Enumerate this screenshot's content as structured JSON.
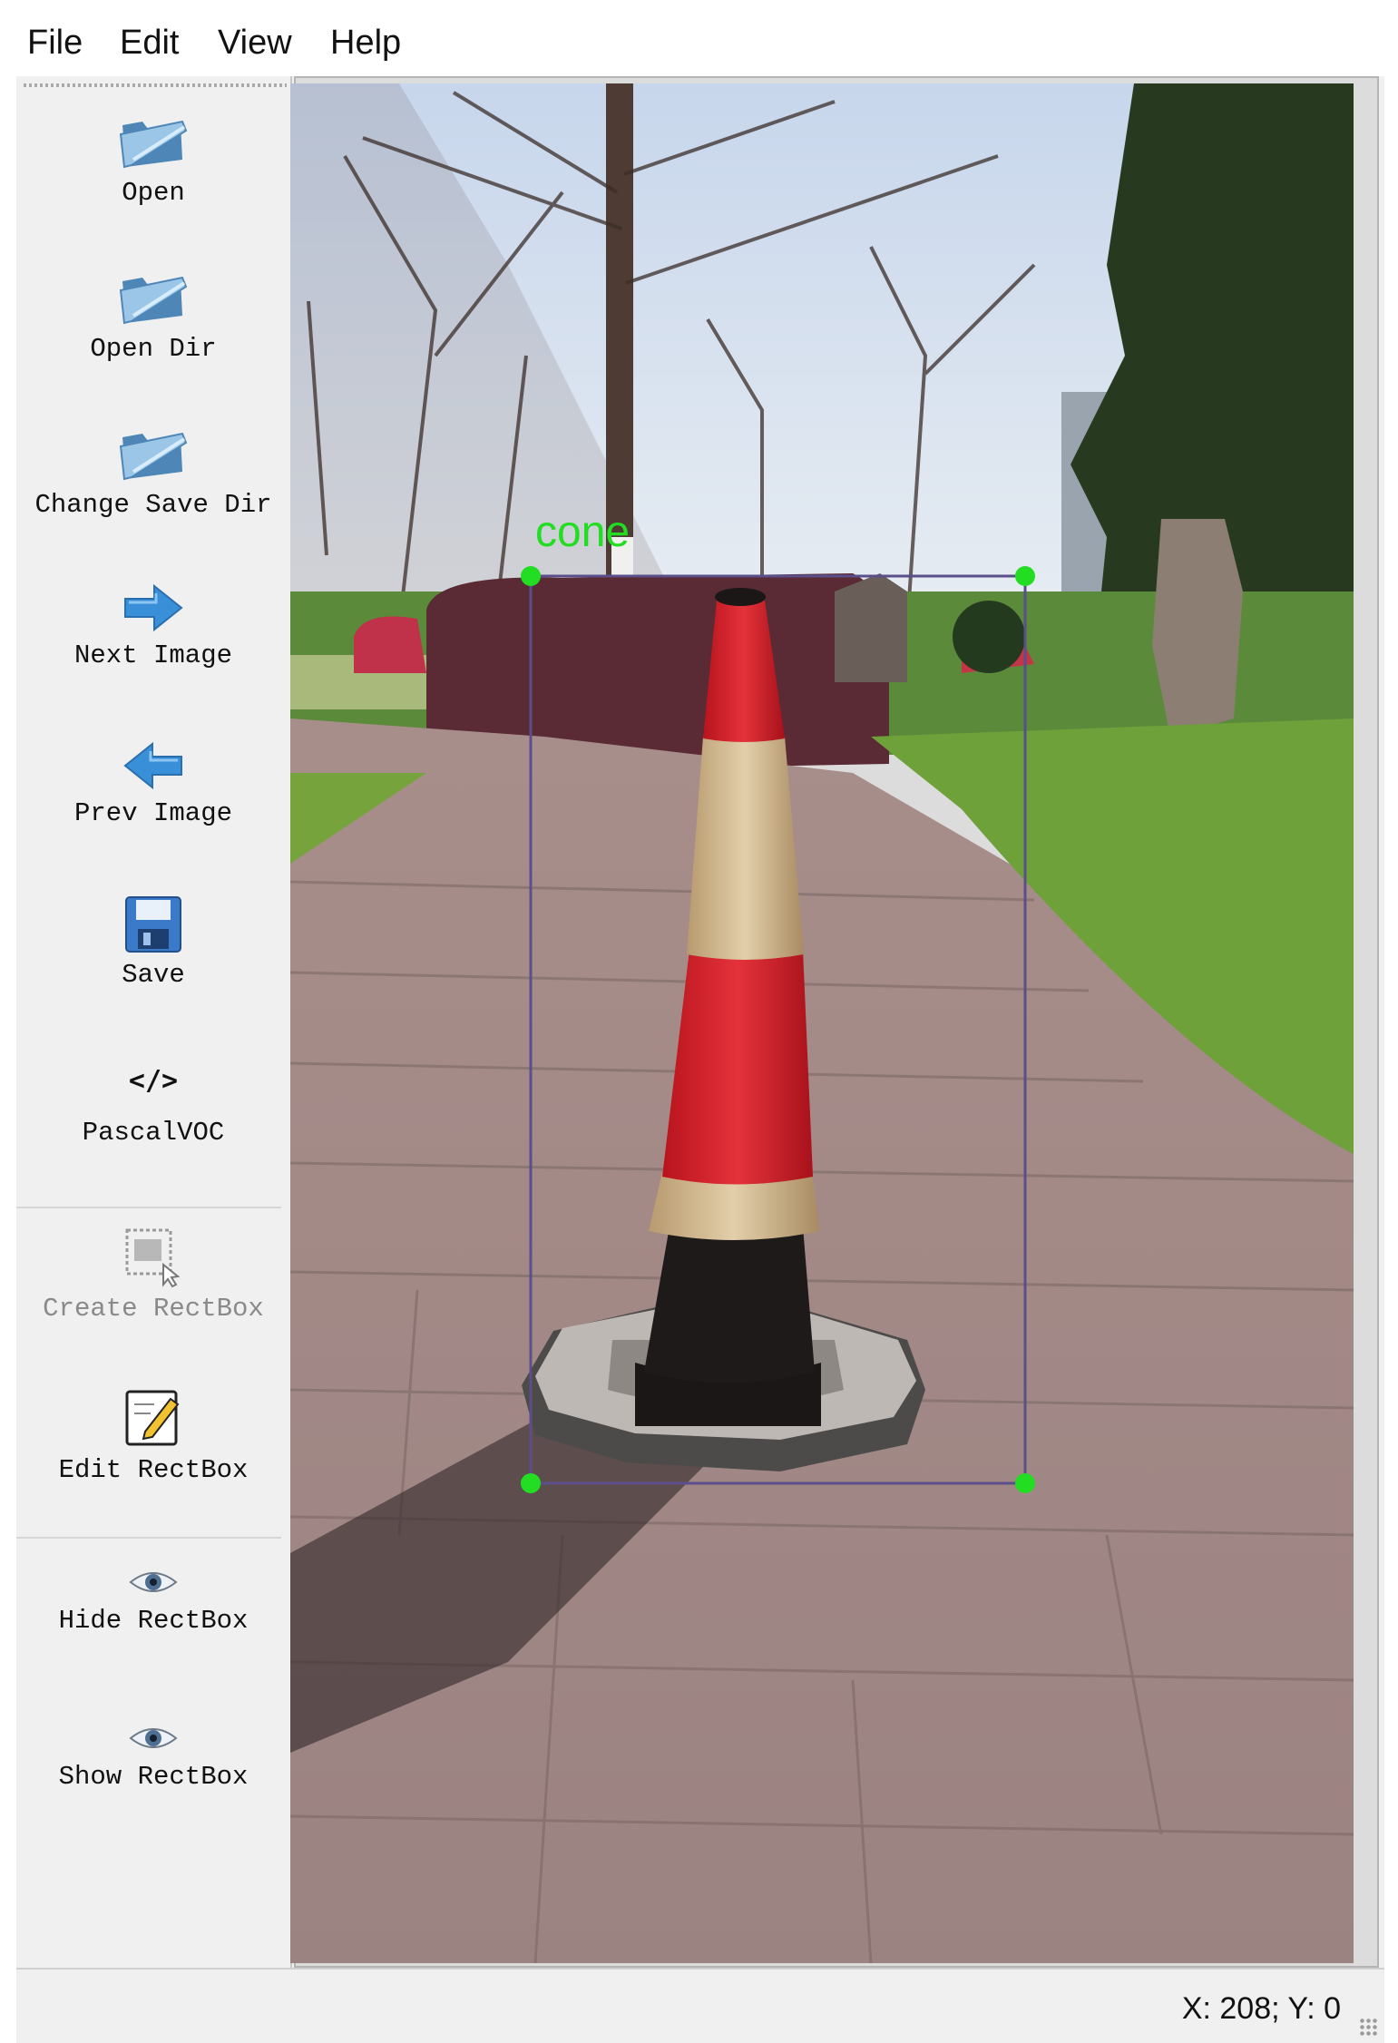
{
  "menu": [
    "File",
    "Edit",
    "View",
    "Help"
  ],
  "toolbar": {
    "open": "Open",
    "open_dir": "Open Dir",
    "change_save_dir": "Change Save Dir",
    "next_image": "Next Image",
    "prev_image": "Prev Image",
    "save": "Save",
    "format": "PascalVOC",
    "format_icon_text": "</>",
    "create_rectbox": "Create RectBox",
    "edit_rectbox": "Edit RectBox",
    "hide_rectbox": "Hide RectBox",
    "show_rectbox": "Show RectBox"
  },
  "annotation": {
    "label": "cone",
    "color": "#22dd22",
    "box_color": "#5a4f8a"
  },
  "status": {
    "coords": "X: 208; Y: 0"
  },
  "colors": {
    "folder": "#7fb0d8",
    "arrow": "#3a8fd9",
    "save_disk": "#3a7ac8"
  }
}
